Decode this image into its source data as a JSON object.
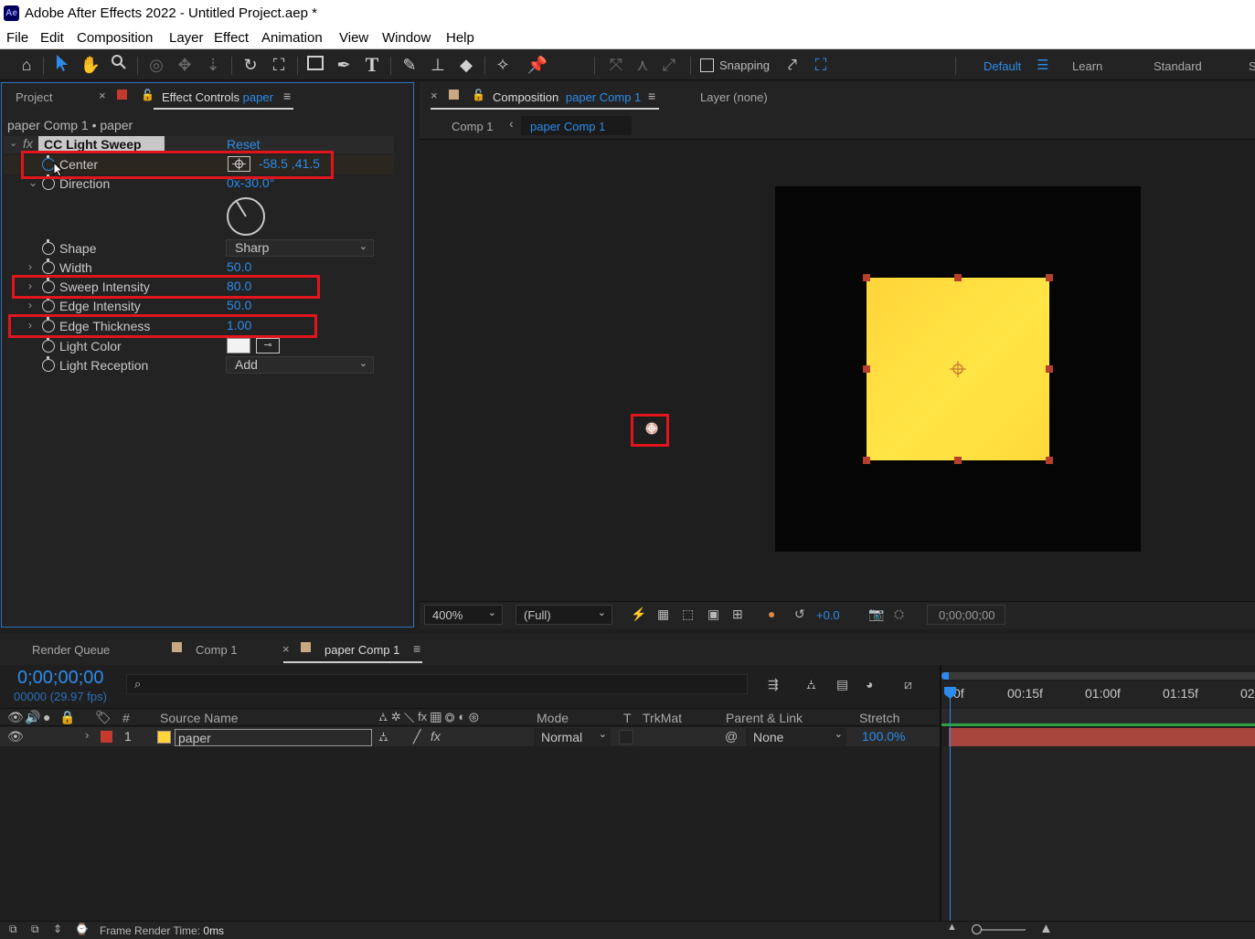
{
  "titlebar": {
    "logo": "Ae",
    "title": "Adobe After Effects 2022 - Untitled Project.aep *"
  },
  "menu": [
    "File",
    "Edit",
    "Composition",
    "Layer",
    "Effect",
    "Animation",
    "View",
    "Window",
    "Help"
  ],
  "toolbar": {
    "icons": [
      "home-icon",
      "selection-tool-icon",
      "hand-tool-icon",
      "zoom-tool-icon",
      "orbit-camera-icon",
      "pan-camera-icon",
      "dolly-camera-icon",
      "rotation-tool-icon",
      "pan-behind-icon",
      "rectangle-tool-icon",
      "pen-tool-icon",
      "type-tool-icon",
      "brush-tool-icon",
      "clone-stamp-icon",
      "eraser-tool-icon",
      "roto-brush-icon",
      "puppet-pin-icon"
    ],
    "snapping_label": "Snapping",
    "workspaces": {
      "default": "Default",
      "learn": "Learn",
      "standard": "Standard",
      "more": "S"
    }
  },
  "left_panel": {
    "tab_project": "Project",
    "tab_effect_controls": "Effect Controls",
    "tab_effect_layer": "paper",
    "breadcrumb": "paper Comp 1 • paper",
    "effect_name": "CC Light Sweep",
    "reset": "Reset",
    "properties": {
      "center_label": "Center",
      "center_value": "-58.5 ,41.5",
      "direction_label": "Direction",
      "direction_value": "0x-30.0°",
      "shape_label": "Shape",
      "shape_value": "Sharp",
      "width_label": "Width",
      "width_value": "50.0",
      "sweep_intensity_label": "Sweep Intensity",
      "sweep_intensity_value": "80.0",
      "edge_intensity_label": "Edge Intensity",
      "edge_intensity_value": "50.0",
      "edge_thickness_label": "Edge Thickness",
      "edge_thickness_value": "1.00",
      "light_color_label": "Light Color",
      "light_color": "#f2f2f2",
      "light_reception_label": "Light Reception",
      "light_reception_value": "Add"
    }
  },
  "comp_panel": {
    "tab_label": "Composition",
    "tab_comp": "paper Comp 1",
    "layer_tab": "Layer (none)",
    "nav_comp1": "Comp 1",
    "nav_active": "paper Comp 1",
    "zoom": "400%",
    "resolution": "(Full)",
    "exposure": "+0.0",
    "timecode": "0;00;00;00",
    "layer_color_top": "#ffd53a",
    "layer_color_bottom": "#ffe545"
  },
  "timeline": {
    "tab_render_queue": "Render Queue",
    "tab_comp1": "Comp 1",
    "tab_paper_comp": "paper Comp 1",
    "timecode": "0;00;00;00",
    "fps": "00000 (29.97 fps)",
    "search_placeholder": "",
    "columns": {
      "hash": "#",
      "source_name": "Source Name",
      "mode": "Mode",
      "t": "T",
      "trkmat": "TrkMat",
      "parent_link": "Parent & Link",
      "stretch": "Stretch"
    },
    "layers": [
      {
        "index": "1",
        "name": "paper",
        "mode": "Normal",
        "parent": "None",
        "stretch": "100.0%"
      }
    ],
    "ruler": [
      "0f",
      "00:15f",
      "01:00f",
      "01:15f",
      "02"
    ],
    "footer_label": "Frame Render Time:",
    "footer_value": "0ms"
  }
}
